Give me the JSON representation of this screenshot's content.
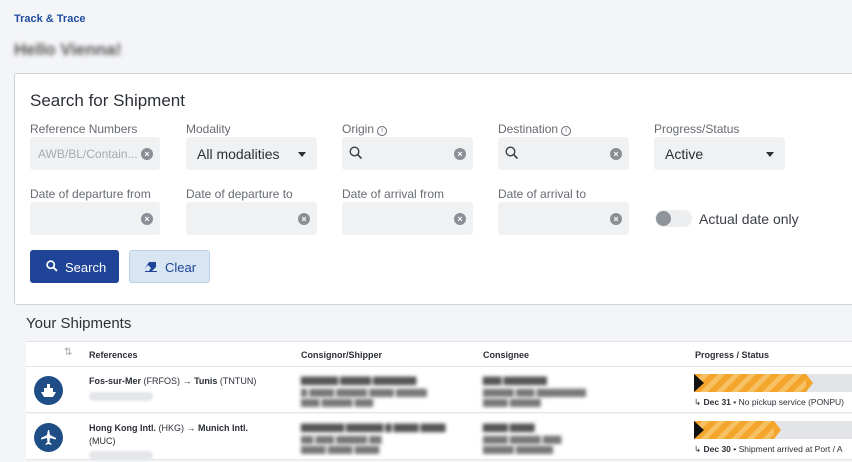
{
  "breadcrumb": "Track & Trace",
  "greeting": "Hello Vienna!",
  "search": {
    "title": "Search for Shipment",
    "fields": {
      "reference_label": "Reference Numbers",
      "reference_placeholder": "AWB/BL/Contain...",
      "modality_label": "Modality",
      "modality_value": "All modalities",
      "origin_label": "Origin",
      "destination_label": "Destination",
      "progress_label": "Progress/Status",
      "progress_value": "Active",
      "dep_from_label": "Date of departure from",
      "dep_to_label": "Date of departure to",
      "arr_from_label": "Date of arrival from",
      "arr_to_label": "Date of arrival to",
      "actual_date_label": "Actual date only"
    },
    "search_button": "Search",
    "clear_button": "Clear"
  },
  "shipments": {
    "title": "Your Shipments",
    "columns": {
      "references": "References",
      "consignor": "Consignor/Shipper",
      "consignee": "Consignee",
      "progress": "Progress / Status"
    },
    "rows": [
      {
        "mode_icon": "ship-icon",
        "origin": "Fos-sur-Mer",
        "origin_code": "(FRFOS)",
        "arrow": "→",
        "destination": "Tunis",
        "destination_code": "(TNTUN)",
        "destination_code_line2": "",
        "progress": 0.7,
        "status_date": "Dec 31",
        "status_text": "• No pickup service (PONPU)"
      },
      {
        "mode_icon": "airplane-icon",
        "origin": "Hong Kong Intl.",
        "origin_code": "(HKG)",
        "arrow": "→",
        "destination": "Munich Intl.",
        "destination_code": "",
        "destination_code_line2": "(MUC)",
        "progress": 0.5,
        "status_date": "Dec 30",
        "status_text": "• Shipment arrived at Port / A"
      }
    ]
  },
  "colors": {
    "primary": "#1f4497",
    "accent": "#f4a62c",
    "link": "#1f4ea0"
  }
}
